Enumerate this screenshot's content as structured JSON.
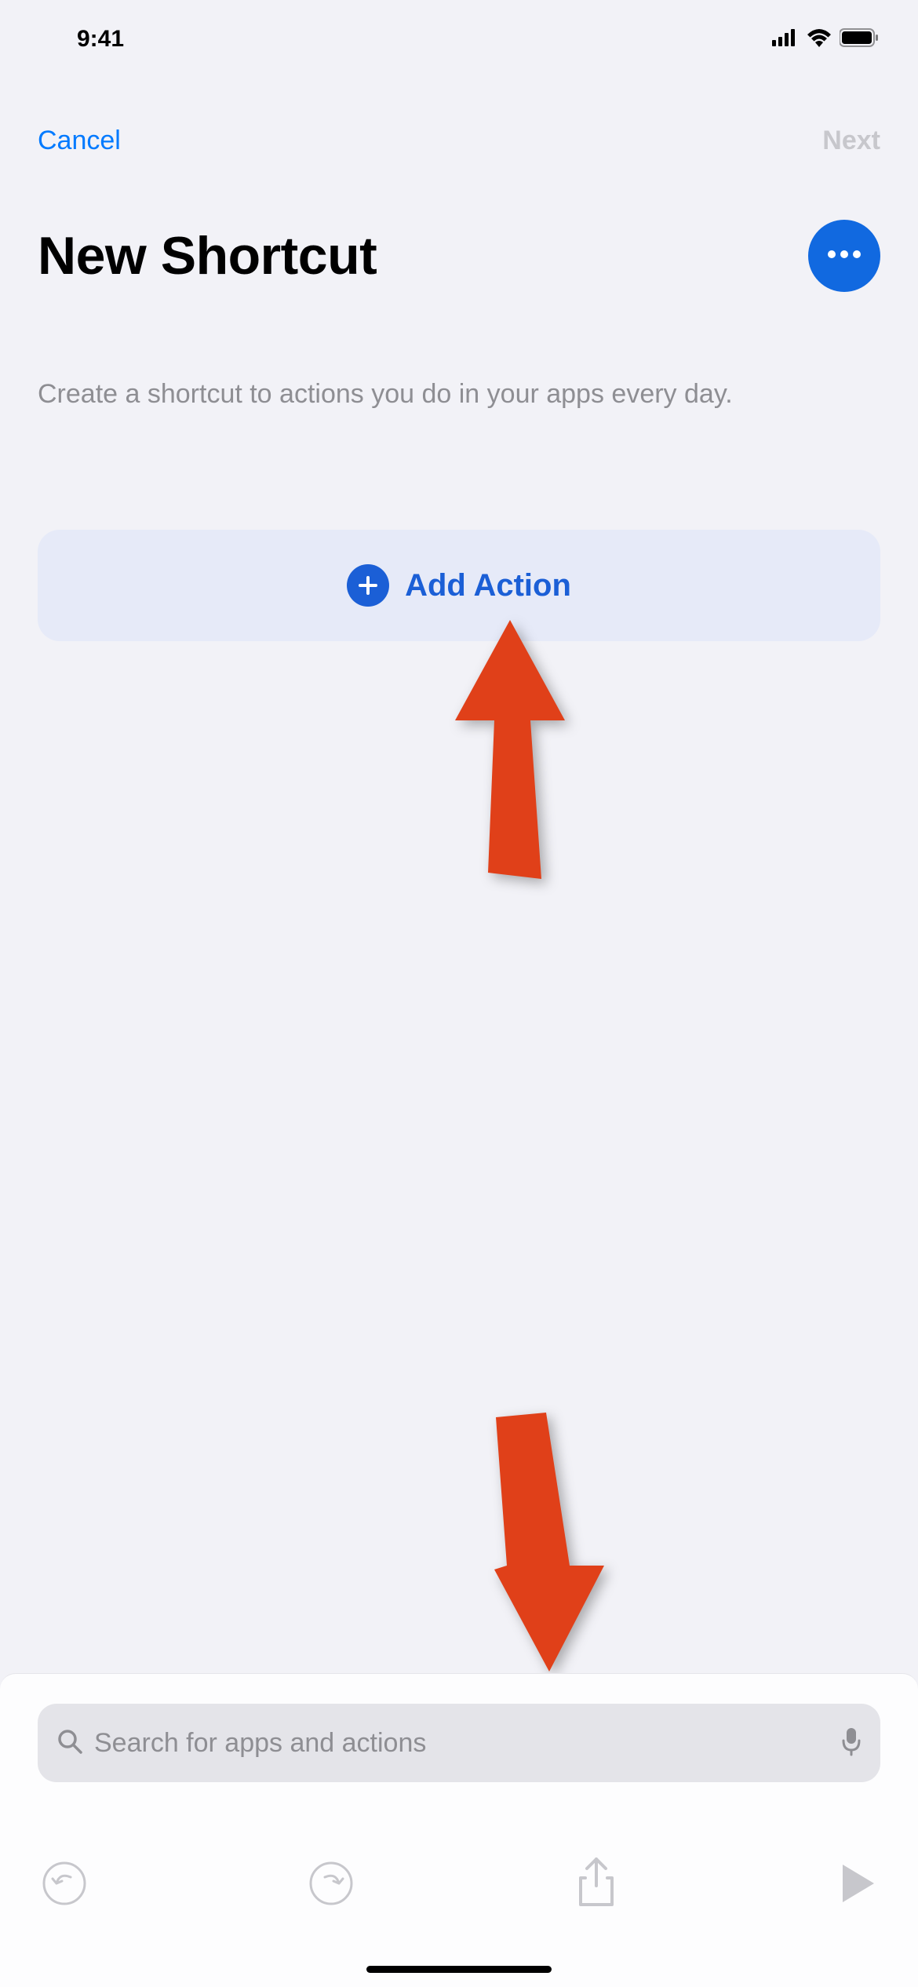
{
  "status_bar": {
    "time": "9:41"
  },
  "nav": {
    "left_label": "Cancel",
    "right_label": "Next"
  },
  "header": {
    "title": "New Shortcut",
    "subtitle": "Create a shortcut to actions you do in your apps every day."
  },
  "add_action": {
    "label": "Add Action"
  },
  "search": {
    "placeholder": "Search for apps and actions"
  },
  "colors": {
    "accent_blue": "#007aff",
    "deep_blue": "#1b5fd6",
    "annotation_red": "#e04019",
    "disabled_gray": "#c7c7cc",
    "secondary_text": "#8e8e93"
  }
}
